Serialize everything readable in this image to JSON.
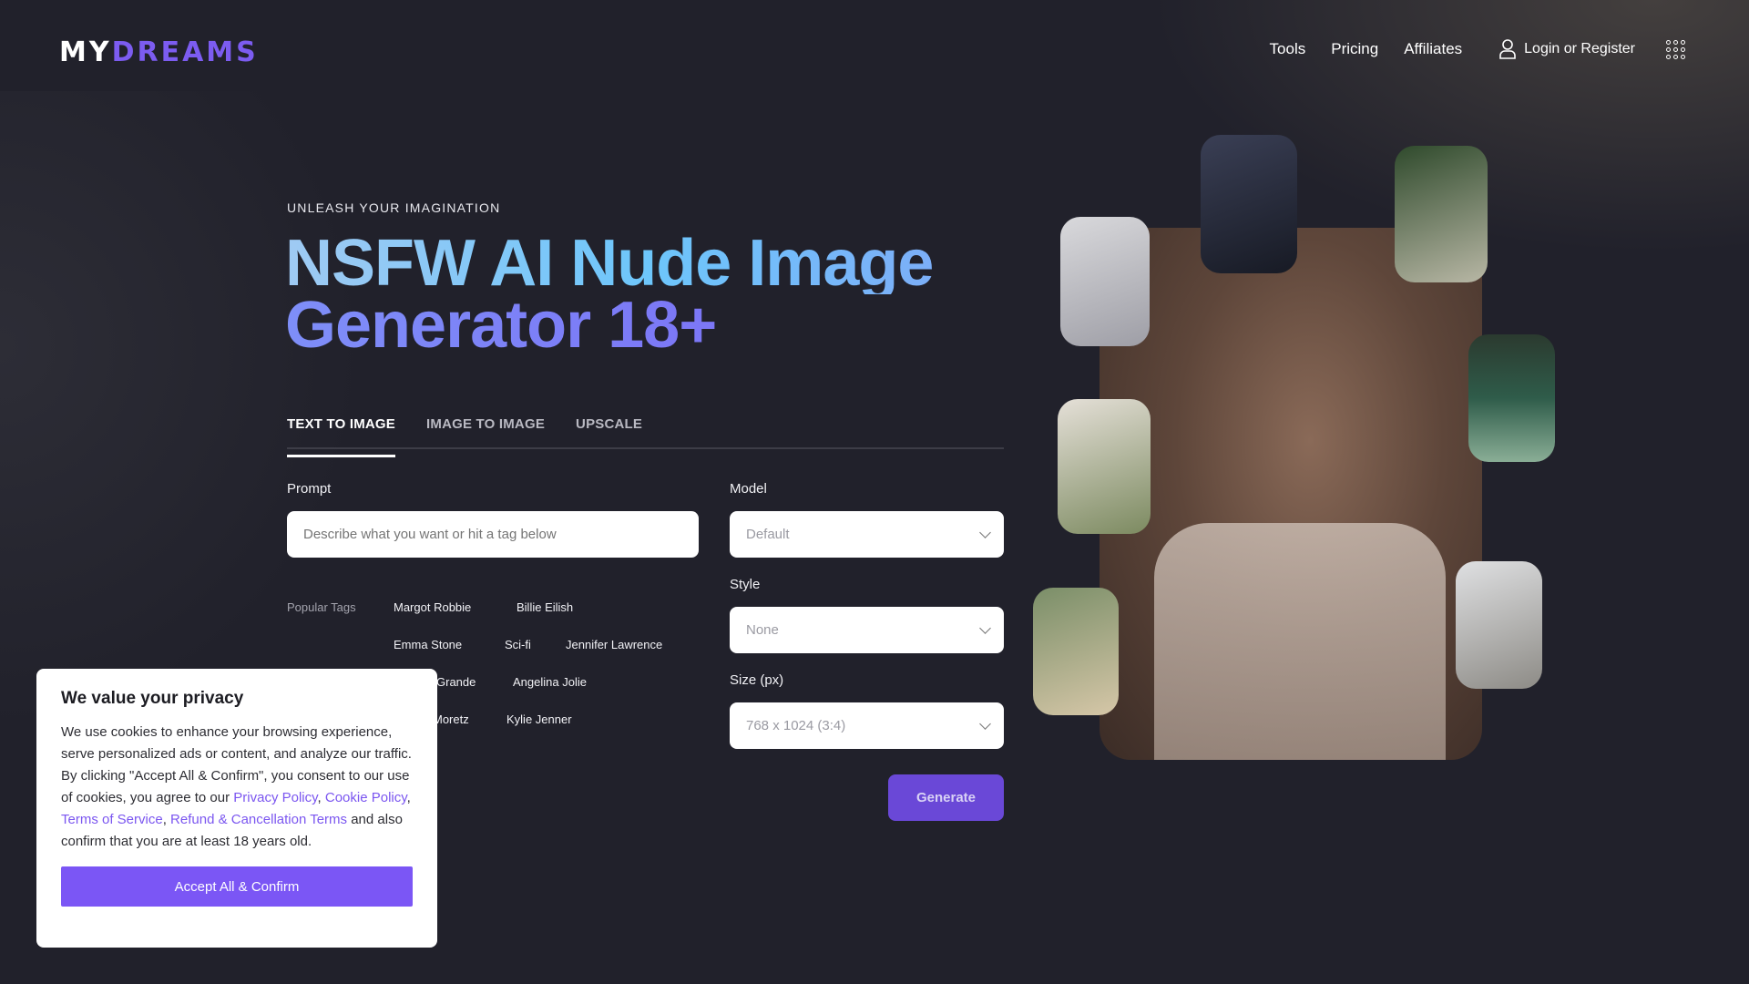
{
  "header": {
    "logo_part1": "MY",
    "logo_part2": "DREAMS",
    "nav": [
      "Tools",
      "Pricing",
      "Affiliates"
    ],
    "login_label": "Login or Register",
    "colors": {
      "brand_purple": "#7c5cf0",
      "background": "#21212b"
    }
  },
  "hero": {
    "eyebrow": "UNLEASH YOUR IMAGINATION",
    "title_line1": "NSFW AI Nude Image",
    "title_line2": "Generator 18+"
  },
  "tabs": [
    {
      "label": "TEXT TO IMAGE",
      "active": true
    },
    {
      "label": "IMAGE TO IMAGE",
      "active": false
    },
    {
      "label": "UPSCALE",
      "active": false
    }
  ],
  "form": {
    "prompt_label": "Prompt",
    "prompt_placeholder": "Describe what you want or hit a tag below",
    "prompt_value": "",
    "popular_tags_label": "Popular Tags",
    "tags": [
      "Margot Robbie",
      "Billie Eilish",
      "Emma Stone",
      "Sci-fi",
      "Jennifer Lawrence",
      "Grande",
      "Angelina Jolie",
      "Moretz",
      "Kylie Jenner"
    ],
    "model_label": "Model",
    "model_value": "Default",
    "style_label": "Style",
    "style_value": "None",
    "size_label": "Size (px)",
    "size_value": "768 x 1024 (3:4)",
    "generate_label": "Generate",
    "generate_color": "#6a48d7"
  },
  "gallery": {
    "main_image": "generated-portrait-image",
    "thumbnails": [
      "thumbnail-1",
      "thumbnail-2",
      "thumbnail-3",
      "thumbnail-4",
      "thumbnail-5",
      "thumbnail-6",
      "thumbnail-7"
    ]
  },
  "cookie": {
    "title": "We value your privacy",
    "text1": "We use cookies to enhance your browsing experience, serve personalized ads or content, and analyze our traffic. By clicking \"Accept All & Confirm\", you consent to our use of cookies, you agree to our ",
    "link_privacy": "Privacy Policy",
    "sep1": ", ",
    "link_cookie": "Cookie Policy",
    "sep2": ", ",
    "link_terms": "Terms of Service",
    "sep3": ", ",
    "link_refund": "Refund & Cancellation Terms",
    "text2": " and also confirm that you are at least 18 years old.",
    "accept_label": "Accept All & Confirm",
    "link_color": "#7b56f0"
  }
}
